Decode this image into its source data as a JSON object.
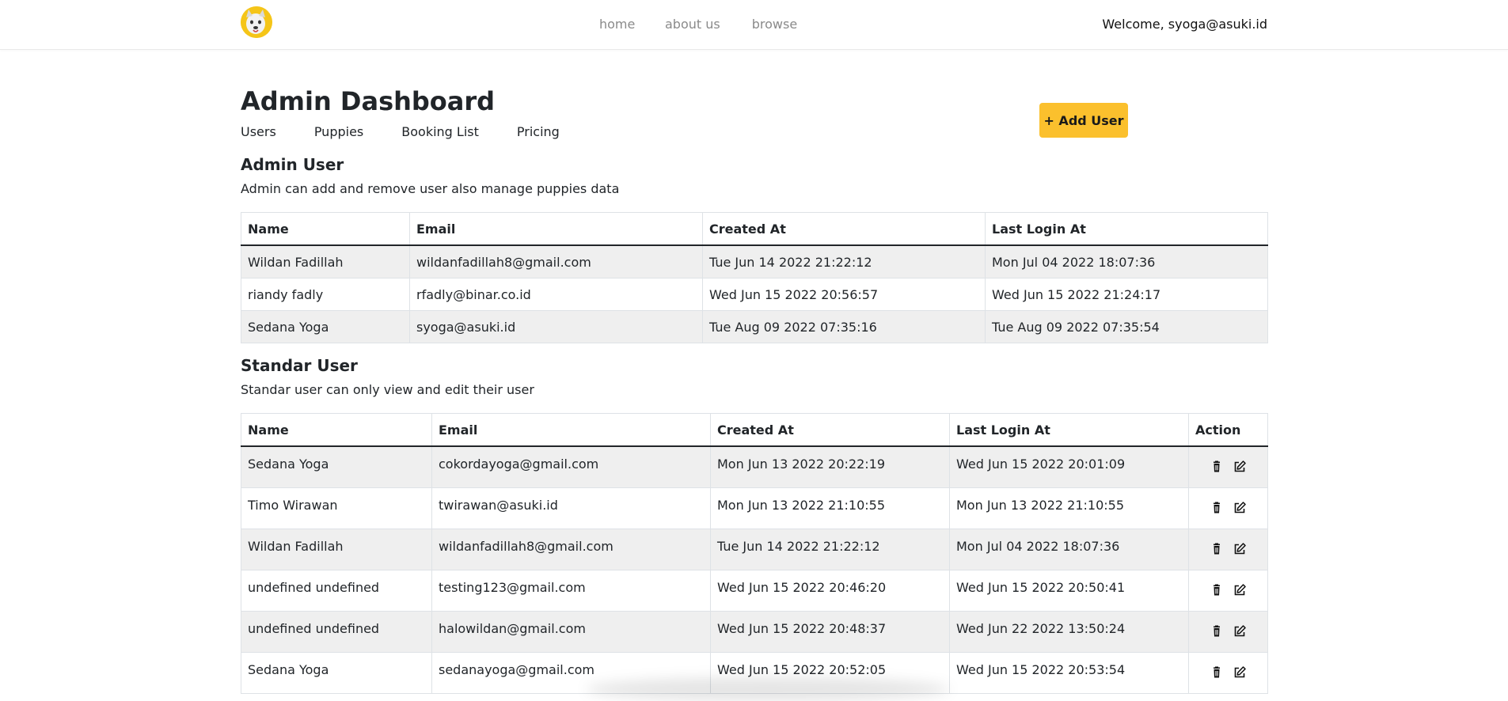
{
  "nav": {
    "logo": "puppy-logo",
    "links": [
      {
        "label": "home"
      },
      {
        "label": "about us"
      },
      {
        "label": "browse"
      }
    ],
    "welcome": "Welcome, syoga@asuki.id"
  },
  "header": {
    "title": "Admin Dashboard",
    "tabs": [
      {
        "label": "Users"
      },
      {
        "label": "Puppies"
      },
      {
        "label": "Booking List"
      },
      {
        "label": "Pricing"
      }
    ],
    "add_user_label": "+ Add User"
  },
  "admin_section": {
    "title": "Admin User",
    "description": "Admin can add and remove user also manage puppies data",
    "columns": [
      "Name",
      "Email",
      "Created At",
      "Last Login At"
    ],
    "rows": [
      [
        "Wildan Fadillah",
        "wildanfadillah8@gmail.com",
        "Tue Jun 14 2022 21:22:12",
        "Mon Jul 04 2022 18:07:36"
      ],
      [
        "riandy fadly",
        "rfadly@binar.co.id",
        "Wed Jun 15 2022 20:56:57",
        "Wed Jun 15 2022 21:24:17"
      ],
      [
        "Sedana Yoga",
        "syoga@asuki.id",
        "Tue Aug 09 2022 07:35:16",
        "Tue Aug 09 2022 07:35:54"
      ]
    ]
  },
  "standard_section": {
    "title": "Standar User",
    "description": "Standar user can only view and edit their user",
    "columns": [
      "Name",
      "Email",
      "Created At",
      "Last Login At",
      "Action"
    ],
    "rows": [
      [
        "Sedana Yoga",
        "cokordayoga@gmail.com",
        "Mon Jun 13 2022 20:22:19",
        "Wed Jun 15 2022 20:01:09"
      ],
      [
        "Timo Wirawan",
        "twirawan@asuki.id",
        "Mon Jun 13 2022 21:10:55",
        "Mon Jun 13 2022 21:10:55"
      ],
      [
        "Wildan Fadillah",
        "wildanfadillah8@gmail.com",
        "Tue Jun 14 2022 21:22:12",
        "Mon Jul 04 2022 18:07:36"
      ],
      [
        "undefined undefined",
        "testing123@gmail.com",
        "Wed Jun 15 2022 20:46:20",
        "Wed Jun 15 2022 20:50:41"
      ],
      [
        "undefined undefined",
        "halowildan@gmail.com",
        "Wed Jun 15 2022 20:48:37",
        "Wed Jun 22 2022 13:50:24"
      ],
      [
        "Sedana Yoga",
        "sedanayoga@gmail.com",
        "Wed Jun 15 2022 20:52:05",
        "Wed Jun 15 2022 20:53:54"
      ]
    ],
    "row_actions": [
      "trash-icon",
      "edit-icon"
    ]
  },
  "colors": {
    "accent": "#fbc02d",
    "nav_link": "#8a8a8a",
    "row_stripe": "#efefef"
  }
}
